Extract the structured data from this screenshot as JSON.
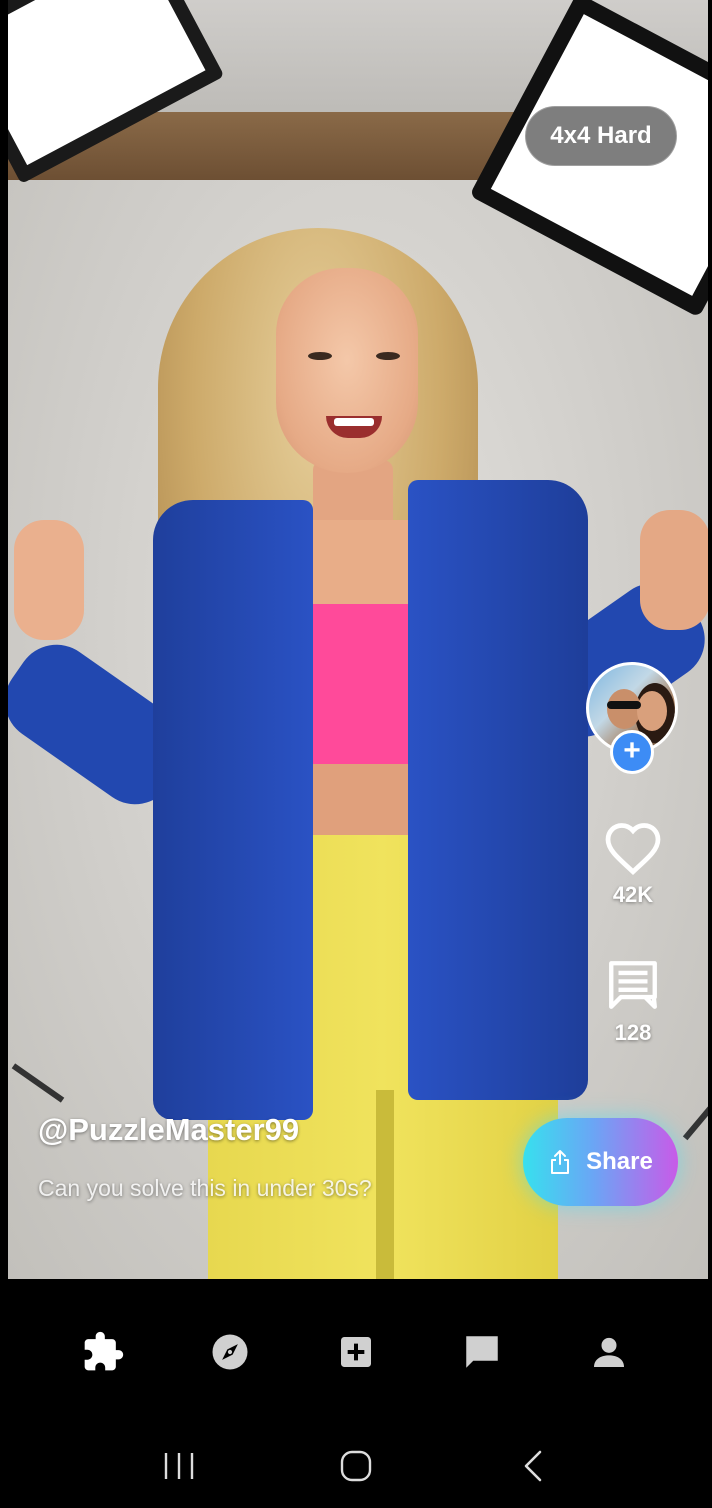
{
  "app": {
    "difficulty_badge": "4x4 Hard"
  },
  "creator": {
    "username": "@PuzzleMaster99",
    "caption": "Can you solve this in under 30s?",
    "follow_symbol": "+"
  },
  "actions": {
    "likes": "42K",
    "comments": "128",
    "share_label": "Share"
  },
  "bottom_nav": {
    "items": [
      {
        "icon": "puzzle-icon",
        "active": true
      },
      {
        "icon": "compass-icon",
        "active": false
      },
      {
        "icon": "add-box-icon",
        "active": false
      },
      {
        "icon": "chat-icon",
        "active": false
      },
      {
        "icon": "person-icon",
        "active": false
      }
    ],
    "active_color": "#ffffff",
    "inactive_color": "#d0d0d0"
  },
  "system_nav": {
    "items": [
      "recents-icon",
      "home-icon",
      "back-icon"
    ]
  },
  "colors": {
    "share_gradient_start": "#37e0ee",
    "share_gradient_end": "#c85be8",
    "follow_button": "#3d8cf5"
  }
}
